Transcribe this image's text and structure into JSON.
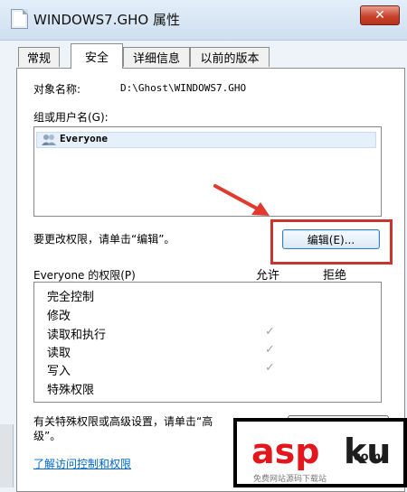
{
  "window": {
    "title": "WINDOWS7.GHO 属性",
    "close_glyph": "✕"
  },
  "tabs": [
    {
      "label": "常规",
      "active": false
    },
    {
      "label": "安全",
      "active": true
    },
    {
      "label": "详细信息",
      "active": false
    },
    {
      "label": "以前的版本",
      "active": false
    }
  ],
  "security": {
    "object_name_label": "对象名称:",
    "object_name_value": "D:\\Ghost\\WINDOWS7.GHO",
    "groups_label": "组或用户名(G):",
    "users": [
      {
        "name": "Everyone",
        "icon": "users-icon",
        "selected": true
      }
    ],
    "edit_hint": "要更改权限，请单击“编辑”。",
    "edit_button": "编辑(E)...",
    "permissions_label": "Everyone 的权限(P)",
    "allow_header": "允许",
    "deny_header": "拒绝",
    "permissions": [
      {
        "name": "完全控制",
        "allow": false,
        "deny": false
      },
      {
        "name": "修改",
        "allow": false,
        "deny": false
      },
      {
        "name": "读取和执行",
        "allow": true,
        "deny": false
      },
      {
        "name": "读取",
        "allow": true,
        "deny": false
      },
      {
        "name": "写入",
        "allow": true,
        "deny": false
      },
      {
        "name": "特殊权限",
        "allow": false,
        "deny": false
      }
    ],
    "check_glyph": "✓",
    "advanced_hint_line1": "有关特殊权限或高级设置，请单击“高",
    "advanced_hint_line2": "级”。",
    "learn_link": "了解访问控制和权限"
  },
  "watermark": {
    "brand_red": "asp",
    "brand_dark": "ku",
    "domain_suffix": ".com",
    "tagline": "免费网站源码下载站"
  },
  "colors": {
    "highlight": "#c9342f",
    "arrow": "#e03a2f",
    "link": "#0066cc",
    "watermark_red": "#e3161e"
  }
}
